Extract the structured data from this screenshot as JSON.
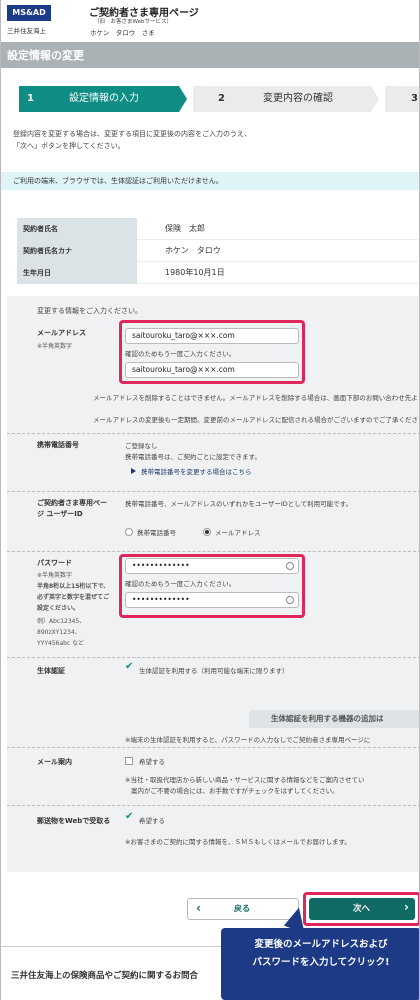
{
  "header": {
    "logo": "MS&AD",
    "company": "三井住友海上",
    "title": "ご契約者さま専用ページ",
    "subtitle": "（旧　お客さまWebサービス）",
    "user_name": "ホケン　タロウ　さま"
  },
  "page_title": "設定情報の変更",
  "steps": [
    {
      "num": "1",
      "label": "設定情報の入力"
    },
    {
      "num": "2",
      "label": "変更内容の確認"
    },
    {
      "num": "3",
      "label": ""
    }
  ],
  "intro": {
    "line1": "登録内容を変更する場合は、変更する項目に変更後の内容をご入力のうえ、",
    "line2": "「次へ」ボタンを押してください。"
  },
  "notice": "ご利用の端末、ブラウザでは、生体認証はご利用いただけません。",
  "contract_info": [
    {
      "label": "契約者氏名",
      "value": "保険　太郎"
    },
    {
      "label": "契約者氏名カナ",
      "value": "ホケン　タロウ"
    },
    {
      "label": "生年月日",
      "value": "1980年10月1日"
    }
  ],
  "form": {
    "instruction": "変更する情報をご入力ください。",
    "email": {
      "label": "メールアドレス",
      "note": "※半角英数字",
      "value": "saitouroku_taro@×××.com",
      "confirm_label": "確認のためもう一度ご入力ください。",
      "confirm_value": "saitouroku_taro@×××.com",
      "help1": "メールアドレスを削除することはできません。メールアドレスを削除する場合は、画面下部のお問い合わせ先よ",
      "help2": "メールアドレスの変更後も一定期間、変更前のメールアドレスに配信される場合がございますのでご了承くださ"
    },
    "mobile": {
      "label": "携帯電話番号",
      "status": "ご登録なし",
      "desc": "携帯電話番号は、ご契約ごとに設定できます。",
      "link": "携帯電話番号を変更する場合はこちら"
    },
    "userid": {
      "label1": "ご契約者さま専用ペー",
      "label2": "ジ ユーザーID",
      "desc": "携帯電話番号、メールアドレスのいずれかをユーザーIDとして利用可能です。",
      "option1": "携帯電話番号",
      "option2": "メールアドレス"
    },
    "password": {
      "label": "パスワード",
      "rules": [
        "※半角英数字",
        "半角8桁以上15桁以下で、",
        "必ず英字と数字を混ぜてご",
        "設定ください。",
        "例）Abc12345、",
        "890zXY1234、",
        "YYY456abc など"
      ],
      "value": "•••••••••••••",
      "confirm_label": "確認のためもう一度ご入力ください。",
      "confirm_value": "•••••••••••••"
    },
    "bio": {
      "label": "生体認証",
      "checkbox": "生体認証を利用する（利用可能な端末に限ります）",
      "device_button": "生体認証を利用する機器の追加は",
      "note": "※端末の生体認証を利用すると、パスワードの入力なしでご契約者さま専用ページに"
    },
    "mail_info": {
      "label": "メール案内",
      "checkbox": "希望する",
      "note1": "※当社・取扱代理店から新しい商品・サービスに関する情報などをご案内させてい",
      "note2": "案内がご不要の場合には、お手数ですがチェックをはずしてください。"
    },
    "web_delivery": {
      "label": "郵送物をWebで受取る",
      "checkbox": "希望する",
      "note": "※お客さまのご契約に関する情報を、ＳＭＳもしくはメールでお届けします。"
    }
  },
  "buttons": {
    "back": "戻る",
    "next": "次へ"
  },
  "callout": {
    "line1": "変更後のメールアドレスおよび",
    "line2": "パスワードを入力してクリック!"
  },
  "footer": "三井住友海上の保険商品やご契約に関するお問合"
}
